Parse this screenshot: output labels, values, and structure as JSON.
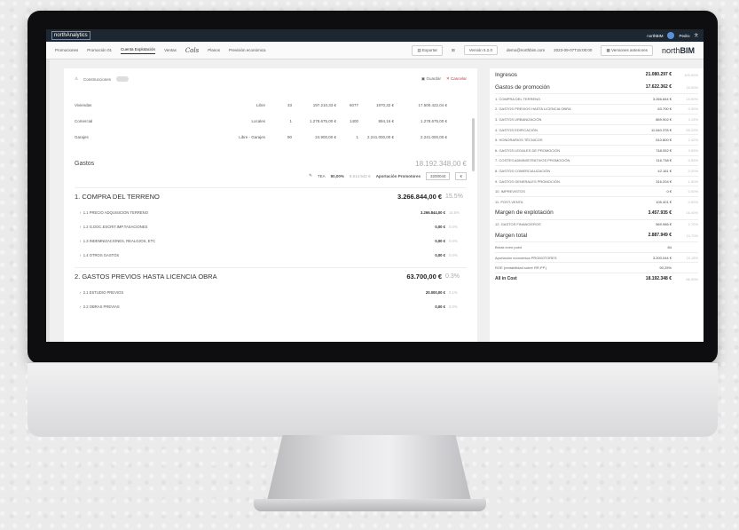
{
  "topbar": {
    "app_title": "northAnalytics",
    "user_short": "northBIM",
    "user_name": "Pedro"
  },
  "nav": {
    "tabs": [
      "Promociones",
      "Promoción 01",
      "Cuenta Explotación",
      "Ventas",
      "Planos",
      "Previsión económica"
    ],
    "signature": "Cols",
    "export_label": "Exportar",
    "version": "Versión 5.2.0",
    "email": "demo@northbim.com",
    "date": "2023-09-07T15:00:00",
    "prev_versions": "Versiones anteriores",
    "brand_light": "north",
    "brand_bold": "BIM"
  },
  "left": {
    "construction_label": "Construcciones",
    "save_label": "Guardar",
    "cancel_label": "Cancelar",
    "units": [
      {
        "name": "Viviendas",
        "type": "Libre",
        "n": "33",
        "price": "197.210,33 €",
        "m2": "6077",
        "pm2": "1970,32 €",
        "total": "17.500.422,04 €"
      },
      {
        "name": "Comercial",
        "type": "Locales",
        "n": "1",
        "price": "1.278.675,00 €",
        "m2": "1400",
        "pm2": "894,16 €",
        "total": "1.278.675,00 €"
      },
      {
        "name": "Garajes",
        "type": "Libre - Garajes",
        "n": "90",
        "price": "24.900,00 €",
        "m2": "1",
        "pm2": "2.241.000,00 €",
        "total": "2.241.000,00 €"
      }
    ],
    "gastos_title": "Gastos",
    "gastos_total": "18.192.348,00 €",
    "tea_label": "TEA",
    "tea_value": "80,00%",
    "tea_amount": "9.514.542 €",
    "aport_label": "Aportación Promotores",
    "aport_value": "3200044",
    "aport_unit": "€",
    "sections": [
      {
        "title": "1. COMPRA DEL TERRENO",
        "value": "3.266.844,00 €",
        "pct": "15.5%",
        "items": [
          {
            "label": "1.1 PRECIO ADQUISICION TERRENO",
            "value": "3.266.844,00 €",
            "pct": "15.5%"
          },
          {
            "label": "1.2 G.DOC.ESCRIT.IMP.TASACIONES",
            "value": "0,00 €",
            "pct": "0.0%"
          },
          {
            "label": "1.3 INDEMNIZACIONES, REALOJOS, ETC",
            "value": "0,00 €",
            "pct": "0.0%"
          },
          {
            "label": "1.4 OTROS GASTOS",
            "value": "0,00 €",
            "pct": "0.0%"
          }
        ]
      },
      {
        "title": "2. GASTOS PREVIOS HASTA LICENCIA OBRA",
        "value": "63.700,00 €",
        "pct": "0.3%",
        "items": [
          {
            "label": "2.1 ESTUDIO PREVIOS",
            "value": "20.000,00 €",
            "pct": "0.1%"
          },
          {
            "label": "2.2 OBRAS PREVIAS",
            "value": "0,00 €",
            "pct": "0.0%"
          }
        ]
      }
    ]
  },
  "right": {
    "ingresos_label": "Ingresos",
    "ingresos_value": "21.080.297 €",
    "ingresos_pct": "100.00%",
    "gastos_label": "Gastos de promoción",
    "gastos_value": "17.622.362 €",
    "gastos_pct": "15.00%",
    "gastos_items": [
      {
        "label": "1. COMPRA DEL TERRENO",
        "value": "3.266.844 €",
        "pct": "15.50%"
      },
      {
        "label": "2. GASTOS PREVIOS HASTA LICENCIA OBRA",
        "value": "63.700 €",
        "pct": "0.30%"
      },
      {
        "label": "3. GASTOS URBANIZACIÓN",
        "value": "869.902 €",
        "pct": "4.13%"
      },
      {
        "label": "4. GASTOS EDIFICACIÓN",
        "value": "11.640.378 €",
        "pct": "55.22%"
      },
      {
        "label": "5. HONORARIOS TÉCNICOS",
        "value": "510.800 €",
        "pct": "2.42%"
      },
      {
        "label": "6. GASTOS LEGALES DE PROMOCIÓN",
        "value": "748.052 €",
        "pct": "3.55%"
      },
      {
        "label": "7. COSTES ADMINISTRATIVOS PROMOCIÓN",
        "value": "116.738 €",
        "pct": "0.55%"
      },
      {
        "label": "8. GASTOS COMERCIALIZACIÓN",
        "value": "42.161 €",
        "pct": "0.20%"
      },
      {
        "label": "9. GASTOS GENERALES PROMOCIÓN",
        "value": "316.204 €",
        "pct": "1.50%"
      },
      {
        "label": "10. IMPREVISTOS",
        "value": "0 €",
        "pct": "0.00%"
      },
      {
        "label": "11. POST-VENTA",
        "value": "105.401 €",
        "pct": "0.50%"
      }
    ],
    "margen_label": "Margen de explotación",
    "margen_value": "3.457.935 €",
    "margen_pct": "16.40%",
    "fin_label": "12. GASTOS FINANCIEROS",
    "fin_value": "569.986 €",
    "fin_pct": "2.70%",
    "total_label": "Margen total",
    "total_value": "2.887.949 €",
    "total_pct": "13.70%",
    "extras": [
      {
        "label": "Break even point",
        "value": "84",
        "pct": ""
      },
      {
        "label": "Aportación económica PROMOTORES",
        "value": "3.200.044 €",
        "pct": "15.18%"
      },
      {
        "label": "ROE (rentabilidad sobre RR.PP.)",
        "value": "90,25%",
        "pct": ""
      }
    ],
    "allin_label": "All in Cost",
    "allin_value": "18.192.348 €",
    "allin_pct": "86.30%"
  }
}
